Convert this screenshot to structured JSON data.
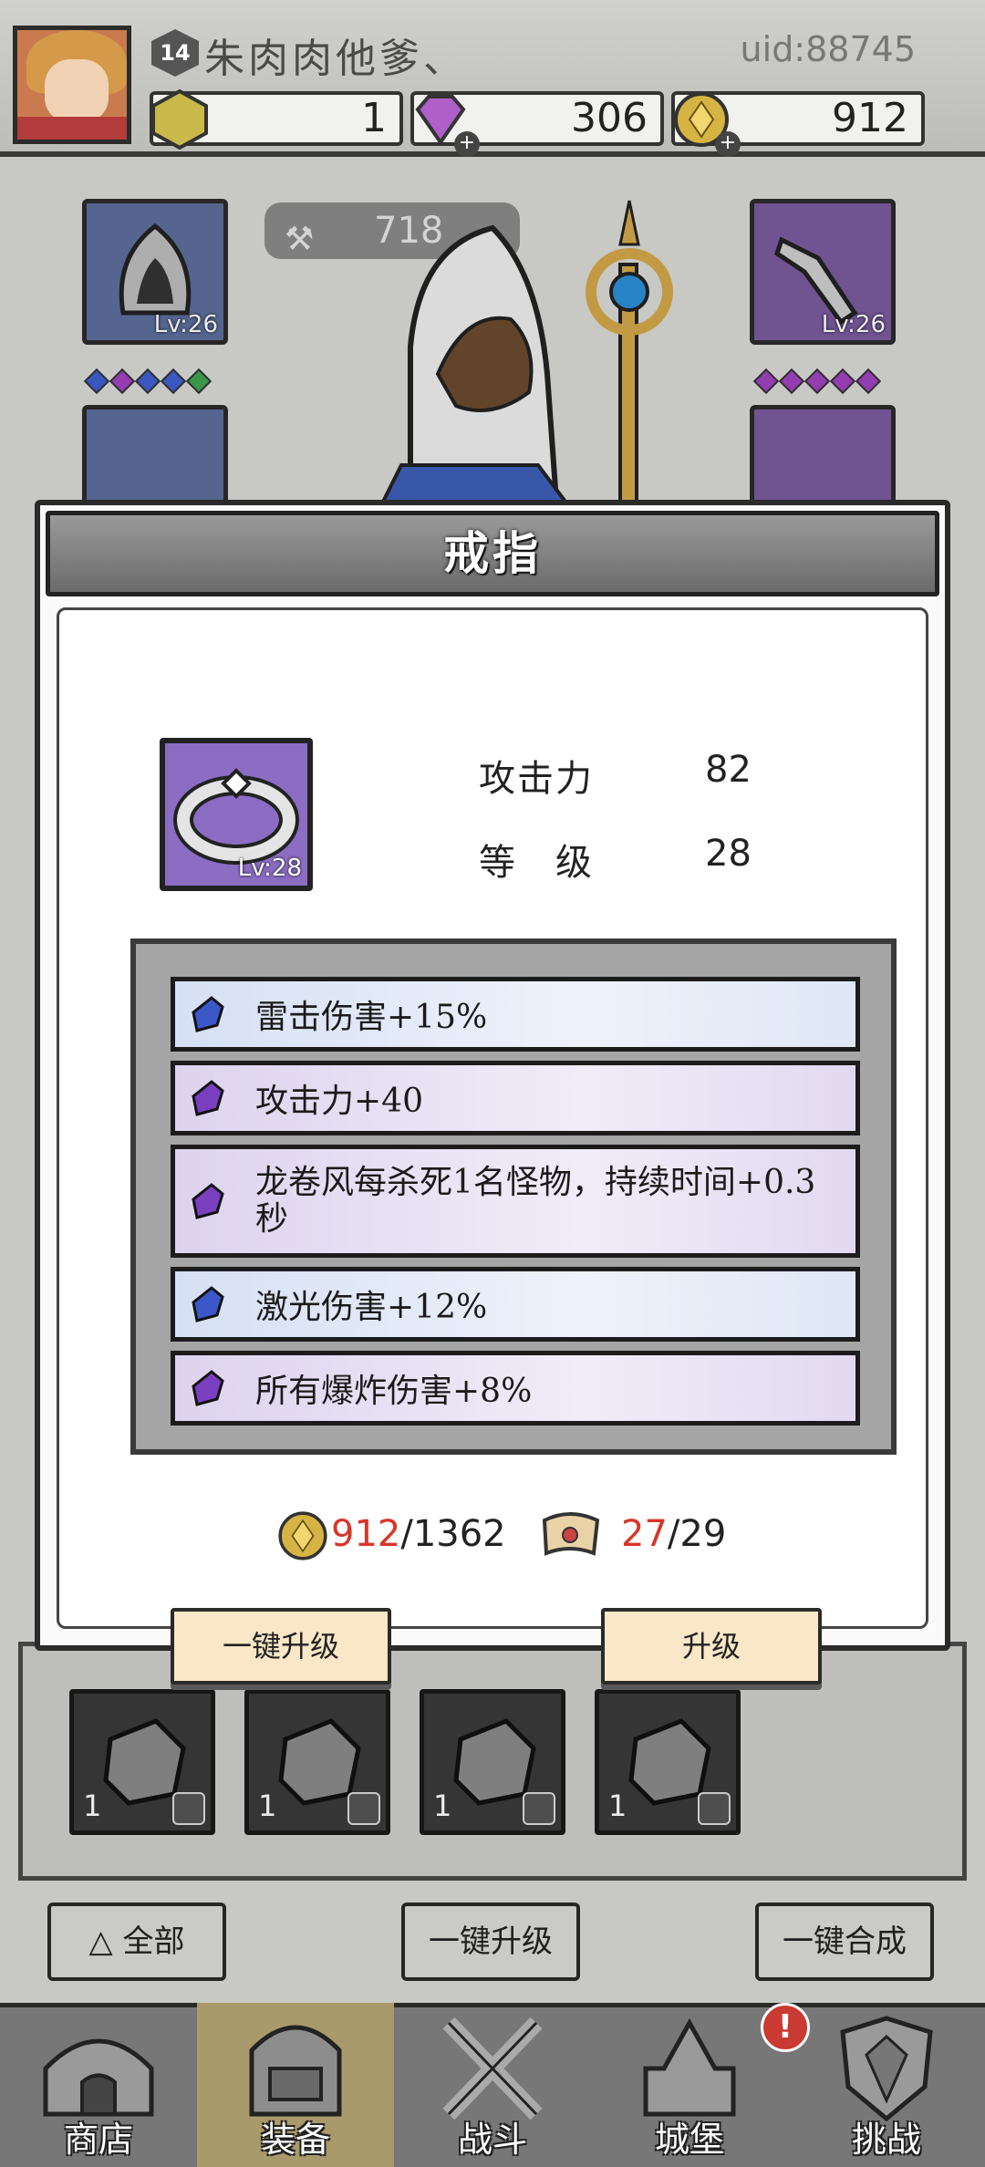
{
  "player": {
    "level": "14",
    "name": "朱肉肉他爹、",
    "uid": "uid:88745"
  },
  "resources": {
    "energy": "1",
    "gems": "306",
    "gold": "912"
  },
  "equipment": {
    "power": "718",
    "left_top_lv": "Lv:26",
    "right_top_lv": "Lv:26"
  },
  "popup": {
    "title": "戒指",
    "item_lv": "Lv:28",
    "stats": [
      {
        "label": "攻击力",
        "value": "82"
      },
      {
        "label": "等　级",
        "value": "28"
      }
    ],
    "affixes": [
      {
        "text": "雷击伤害+15%",
        "color": "blue"
      },
      {
        "text": "攻击力+40",
        "color": "purple"
      },
      {
        "text": "龙卷风每杀死1名怪物，持续时间+0.3秒",
        "color": "purple"
      },
      {
        "text": "激光伤害+12%",
        "color": "blue"
      },
      {
        "text": "所有爆炸伤害+8%",
        "color": "purple"
      }
    ],
    "cost_gold_have": "912",
    "cost_gold_need": "/1362",
    "cost_scroll_have": "27",
    "cost_scroll_need": "/29",
    "btn_auto_upgrade": "一键升级",
    "btn_upgrade": "升级"
  },
  "bag": {
    "slots": [
      {
        "qty": "1"
      },
      {
        "qty": "1"
      },
      {
        "qty": "1"
      },
      {
        "qty": "1"
      }
    ]
  },
  "bottom_bar": {
    "filter_all": "全部",
    "auto_upgrade": "一键升级",
    "auto_merge": "一键合成"
  },
  "nav": {
    "items": [
      {
        "label": "商店"
      },
      {
        "label": "装备"
      },
      {
        "label": "战斗"
      },
      {
        "label": "城堡"
      },
      {
        "label": "挑战"
      }
    ],
    "notification": "!"
  },
  "colors": {
    "accent_red": "#d9352a",
    "item_purple": "#8b6dc3",
    "button_cream": "#f9e7c7"
  }
}
